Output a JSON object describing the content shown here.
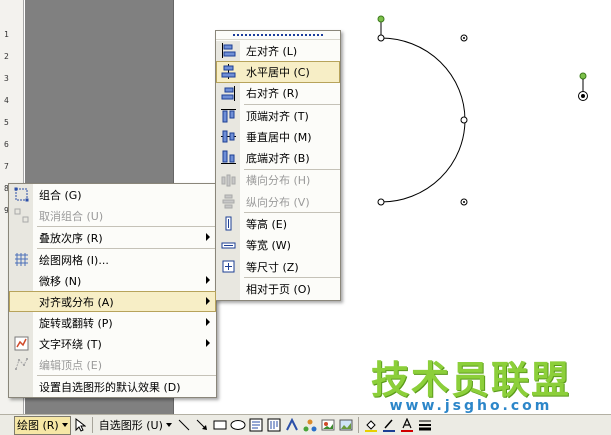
{
  "ruler": {
    "ticks": [
      "1",
      "2",
      "3",
      "4",
      "5",
      "6",
      "7",
      "8",
      "9"
    ]
  },
  "context_menu": {
    "items": [
      {
        "label": "组合 (G)",
        "icon": "group-icon",
        "disabled": false,
        "submenu": false
      },
      {
        "label": "取消组合 (U)",
        "icon": "ungroup-icon",
        "disabled": true,
        "submenu": false
      },
      {
        "label": "叠放次序 (R)",
        "icon": "",
        "disabled": false,
        "submenu": true
      },
      {
        "label": "绘图网格 (I)...",
        "icon": "grid-icon",
        "disabled": false,
        "submenu": false
      },
      {
        "label": "微移 (N)",
        "icon": "",
        "disabled": false,
        "submenu": true
      },
      {
        "label": "对齐或分布 (A)",
        "icon": "",
        "disabled": false,
        "submenu": true,
        "active": true
      },
      {
        "label": "旋转或翻转 (P)",
        "icon": "",
        "disabled": false,
        "submenu": true
      },
      {
        "label": "文字环绕 (T)",
        "icon": "text-wrap-icon",
        "disabled": false,
        "submenu": true
      },
      {
        "label": "编辑顶点 (E)",
        "icon": "edit-points-icon",
        "disabled": true,
        "submenu": false
      },
      {
        "label": "设置自选图形的默认效果 (D)",
        "icon": "",
        "disabled": false,
        "submenu": false
      }
    ]
  },
  "align_submenu": {
    "items": [
      {
        "label": "左对齐 (L)",
        "icon": "align-left-icon",
        "disabled": false
      },
      {
        "label": "水平居中 (C)",
        "icon": "align-center-icon",
        "disabled": false,
        "active": true
      },
      {
        "label": "右对齐 (R)",
        "icon": "align-right-icon",
        "disabled": false
      },
      {
        "label": "顶端对齐 (T)",
        "icon": "align-top-icon",
        "disabled": false
      },
      {
        "label": "垂直居中 (M)",
        "icon": "align-middle-icon",
        "disabled": false
      },
      {
        "label": "底端对齐 (B)",
        "icon": "align-bottom-icon",
        "disabled": false
      },
      {
        "label": "横向分布 (H)",
        "icon": "distribute-horizontal-icon",
        "disabled": true
      },
      {
        "label": "纵向分布 (V)",
        "icon": "distribute-vertical-icon",
        "disabled": true
      },
      {
        "label": "等高 (E)",
        "icon": "same-height-icon",
        "disabled": false
      },
      {
        "label": "等宽 (W)",
        "icon": "same-width-icon",
        "disabled": false
      },
      {
        "label": "等尺寸 (Z)",
        "icon": "same-size-icon",
        "disabled": false
      },
      {
        "label": "相对于页 (O)",
        "icon": "",
        "disabled": false
      }
    ]
  },
  "toolbar": {
    "draw_label": "绘图 (R)",
    "autoshapes_label": "自选图形 (U)"
  },
  "watermark": {
    "title": "技术员联盟",
    "url": "www.jsgho.com"
  },
  "colors": {
    "menu_bg": "#fcfcf9",
    "gutter": "#e8e7e0",
    "highlight": "#f7eec6",
    "highlight_border": "#b7a35b",
    "watermark_green": "#8ccf3a",
    "watermark_blue": "#2c86c9"
  }
}
